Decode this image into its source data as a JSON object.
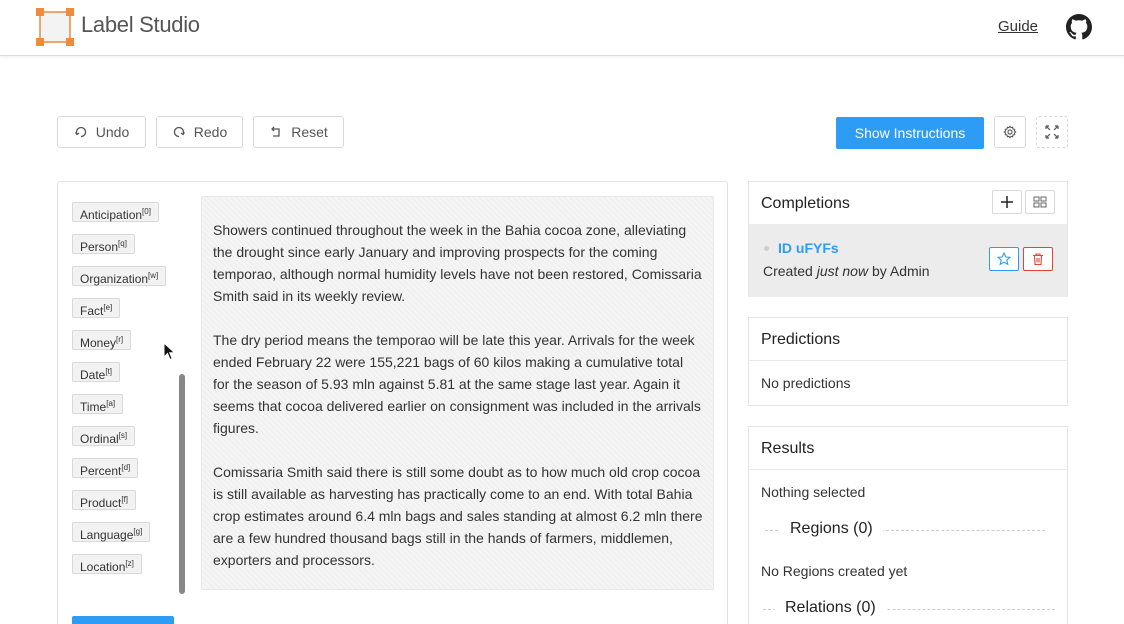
{
  "header": {
    "app_title": "Label Studio",
    "guide_label": "Guide"
  },
  "toolbar": {
    "undo_label": "Undo",
    "redo_label": "Redo",
    "reset_label": "Reset",
    "instructions_label": "Show Instructions"
  },
  "labels": [
    {
      "name": "Anticipation",
      "hotkey": "[0]"
    },
    {
      "name": "Person",
      "hotkey": "[q]"
    },
    {
      "name": "Organization",
      "hotkey": "[w]"
    },
    {
      "name": "Fact",
      "hotkey": "[e]"
    },
    {
      "name": "Money",
      "hotkey": "[r]"
    },
    {
      "name": "Date",
      "hotkey": "[t]"
    },
    {
      "name": "Time",
      "hotkey": "[a]"
    },
    {
      "name": "Ordinal",
      "hotkey": "[s]"
    },
    {
      "name": "Percent",
      "hotkey": "[d]"
    },
    {
      "name": "Product",
      "hotkey": "[f]"
    },
    {
      "name": "Language",
      "hotkey": "[g]"
    },
    {
      "name": "Location",
      "hotkey": "[z]"
    }
  ],
  "document": {
    "paragraphs": [
      "Showers continued throughout the week in the Bahia cocoa zone, alleviating the drought since early January and improving prospects for the coming temporao, although normal humidity levels have not been restored, Comissaria Smith said in its weekly review.",
      "The dry period means the temporao will be late this year. Arrivals for the week ended February 22 were 155,221 bags of 60 kilos making a cumulative total for the season of 5.93 mln against 5.81 at the same stage last year. Again it seems that cocoa delivered earlier on consignment was included in the arrivals figures.",
      "Comissaria Smith said there is still some doubt as to how much old crop cocoa is still available as harvesting has practically come to an end. With total Bahia crop estimates around 6.4 mln bags and sales standing at almost 6.2 mln there are a few hundred thousand bags still in the hands of farmers, middlemen, exporters and processors."
    ]
  },
  "completions": {
    "title": "Completions",
    "item": {
      "id": "ID uFYFs",
      "created_prefix": "Created ",
      "created_when": "just now",
      "created_suffix": " by Admin"
    }
  },
  "predictions": {
    "title": "Predictions",
    "empty": "No predictions"
  },
  "results": {
    "title": "Results",
    "nothing_selected": "Nothing selected",
    "regions_heading": "Regions (0)",
    "no_regions": "No Regions created yet",
    "relations_heading": "Relations (0)"
  },
  "colors": {
    "accent": "#2d9cf5",
    "danger": "#e0443a",
    "logo_orange": "#f08a3c"
  },
  "icons": {
    "logo": "label-studio-logo-icon",
    "github": "github-icon",
    "undo": "undo-icon",
    "redo": "redo-icon",
    "reset": "reset-icon",
    "settings": "gear-icon",
    "fullscreen": "fullscreen-icon",
    "add": "plus-icon",
    "view": "windows-icon",
    "star": "star-icon",
    "delete": "trash-icon"
  }
}
